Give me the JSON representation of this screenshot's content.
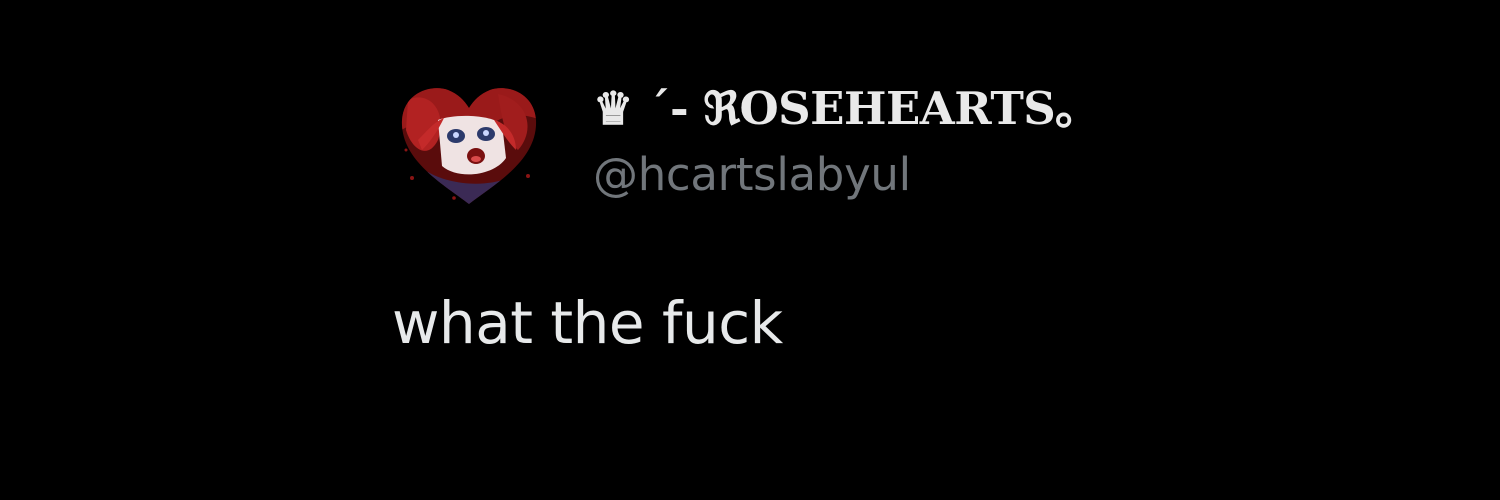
{
  "tweet": {
    "author": {
      "display_name": "♛ ´- ℜOSEHEARTS｡",
      "handle": "@hcartslabyul",
      "avatar_icon": "heart-shaped-anime-avatar"
    },
    "text": "what the fuck"
  },
  "colors": {
    "background": "#000000",
    "display_name": "#e9e9e9",
    "handle": "#71767b",
    "text": "#e7e9ea",
    "avatar_hair": "#8a1414"
  }
}
